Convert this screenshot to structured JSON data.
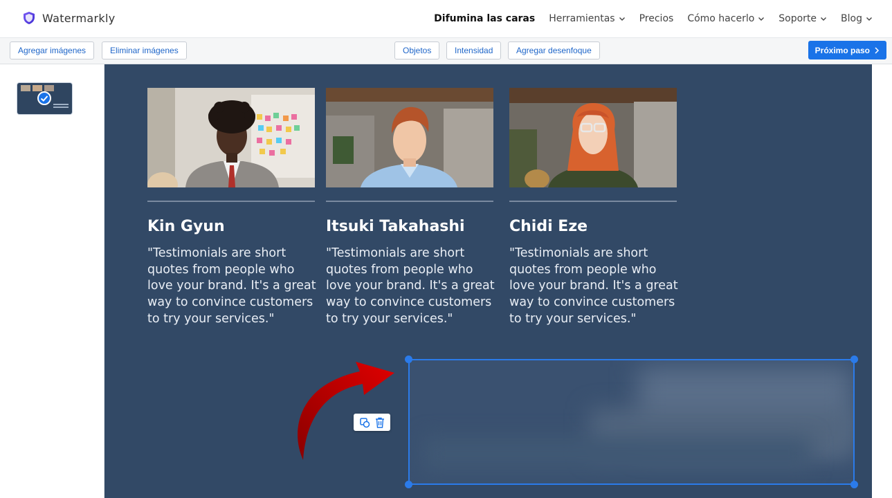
{
  "brand": {
    "name": "Watermarkly"
  },
  "nav": {
    "items": [
      {
        "label": "Difumina las caras",
        "active": true,
        "dropdown": false
      },
      {
        "label": "Herramientas",
        "active": false,
        "dropdown": true
      },
      {
        "label": "Precios",
        "active": false,
        "dropdown": false
      },
      {
        "label": "Cómo hacerlo",
        "active": false,
        "dropdown": true
      },
      {
        "label": "Soporte",
        "active": false,
        "dropdown": true
      },
      {
        "label": "Blog",
        "active": false,
        "dropdown": true
      }
    ]
  },
  "toolbar": {
    "add_images": "Agregar imágenes",
    "remove_images": "Eliminar imágenes",
    "objects": "Objetos",
    "intensity": "Intensidad",
    "add_blur": "Agregar desenfoque",
    "next_step": "Próximo paso"
  },
  "testimonials": [
    {
      "name": "Kin Gyun",
      "quote": "\"Testimonials are short quotes from people who love your brand. It's a great way to convince customers to try your services.\""
    },
    {
      "name": "Itsuki Takahashi",
      "quote": "\"Testimonials are short quotes from people who love your brand. It's a great way to convince customers to try your services.\""
    },
    {
      "name": "Chidi Eze",
      "quote": "\"Testimonials are short quotes from people who love your brand. It's a great way to convince customers to try your services.\""
    }
  ],
  "colors": {
    "accent": "#1a73e8",
    "canvas_bg": "#324966",
    "selection": "#2b7bea",
    "arrow": "#c00000"
  },
  "icons": {
    "brand": "shield-icon",
    "selected_thumb": "checkmark-icon",
    "duplicate": "duplicate-icon",
    "delete": "trash-icon",
    "next": "chevron-right-icon"
  }
}
